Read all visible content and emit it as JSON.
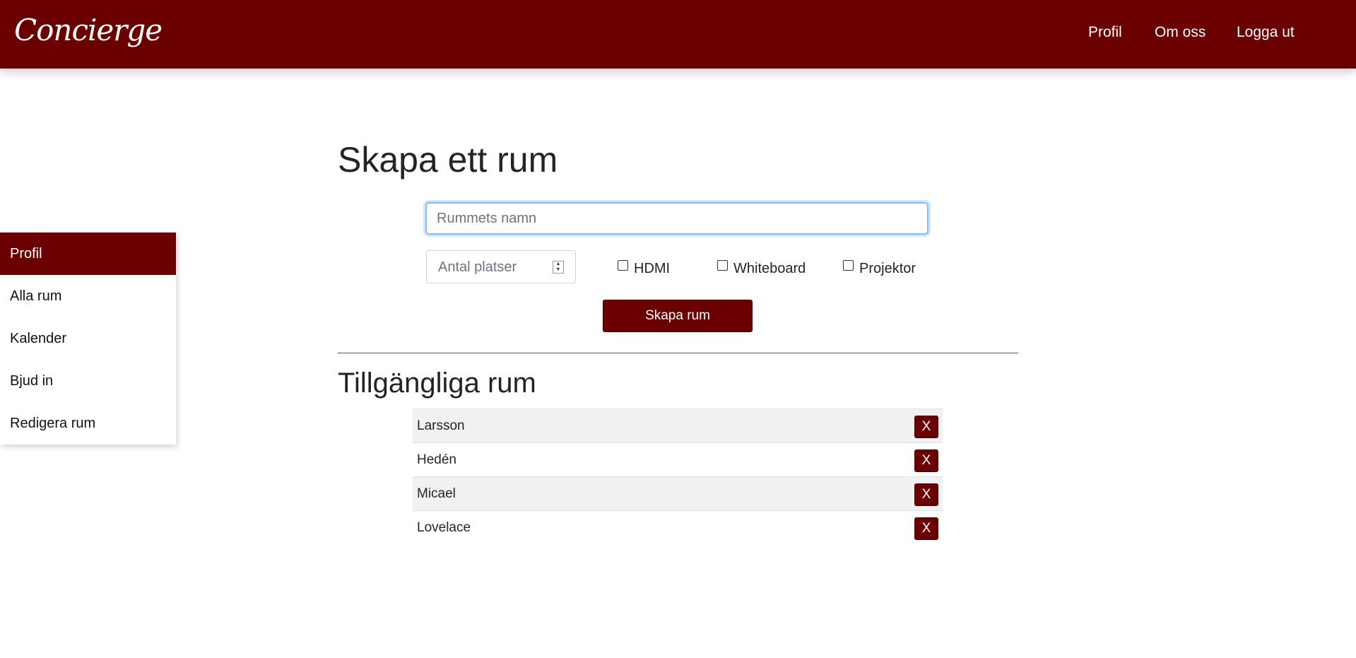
{
  "header": {
    "brand": "Concierge",
    "nav": [
      "Profil",
      "Om oss",
      "Logga ut"
    ]
  },
  "sidebar": {
    "items": [
      {
        "label": "Profil",
        "active": true
      },
      {
        "label": "Alla rum",
        "active": false
      },
      {
        "label": "Kalender",
        "active": false
      },
      {
        "label": "Bjud in",
        "active": false
      },
      {
        "label": "Redigera rum",
        "active": false
      }
    ]
  },
  "create_form": {
    "title": "Skapa ett rum",
    "name_placeholder": "Rummets namn",
    "name_value": "",
    "spots_placeholder": "Antal platser",
    "checkboxes": [
      {
        "label": "HDMI",
        "checked": false
      },
      {
        "label": "Whiteboard",
        "checked": false
      },
      {
        "label": "Projektor",
        "checked": false
      }
    ],
    "submit_label": "Skapa rum"
  },
  "rooms": {
    "title": "Tillgängliga rum",
    "delete_label": "X",
    "items": [
      "Larsson",
      "Hedén",
      "Micael",
      "Lovelace"
    ]
  },
  "colors": {
    "brand": "#6b0000",
    "focus_border": "#80bdff"
  }
}
